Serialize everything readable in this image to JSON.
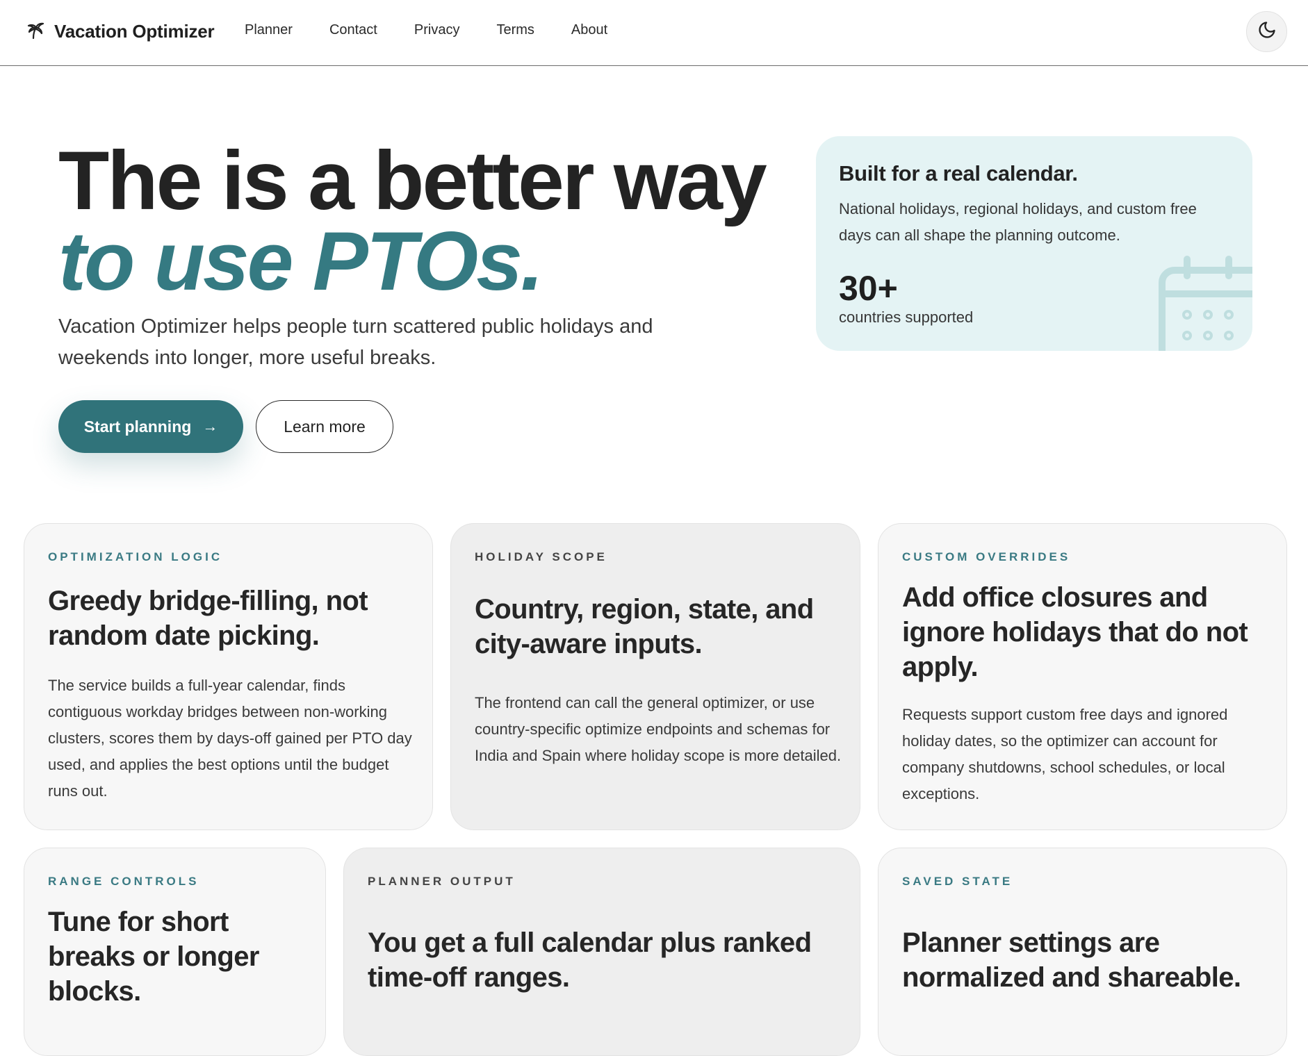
{
  "header": {
    "brand": "Vacation Optimizer",
    "nav": [
      "Planner",
      "Contact",
      "Privacy",
      "Terms",
      "About"
    ]
  },
  "hero": {
    "title_line1": "The is a better way",
    "title_line2": "to use PTOs.",
    "subtitle": "Vacation Optimizer helps people turn scattered public holidays and weekends into longer, more useful breaks.",
    "primary_cta": "Start planning",
    "secondary_cta": "Learn more"
  },
  "side_card": {
    "title": "Built for a real calendar.",
    "description": "National holidays, regional holidays, and custom free days can all shape the planning outcome.",
    "stat": "30+",
    "stat_label": "countries supported"
  },
  "cards": [
    {
      "eyebrow": "OPTIMIZATION LOGIC",
      "title": "Greedy bridge-filling, not random date picking.",
      "body": "The service builds a full-year calendar, finds contiguous workday bridges between non-working clusters, scores them by days-off gained per PTO day used, and applies the best options until the budget runs out."
    },
    {
      "eyebrow": "HOLIDAY SCOPE",
      "title": "Country, region, state, and city-aware inputs.",
      "body": "The frontend can call the general optimizer, or use country-specific optimize endpoints and schemas for India and Spain where holiday scope is more detailed."
    },
    {
      "eyebrow": "CUSTOM OVERRIDES",
      "title": "Add office closures and ignore holidays that do not apply.",
      "body": "Requests support custom free days and ignored holiday dates, so the optimizer can account for company shutdowns, school schedules, or local exceptions."
    },
    {
      "eyebrow": "RANGE CONTROLS",
      "title": "Tune for short breaks or longer blocks."
    },
    {
      "eyebrow": "PLANNER OUTPUT",
      "title": "You get a full calendar plus ranked time-off ranges."
    },
    {
      "eyebrow": "SAVED STATE",
      "title": "Planner settings are normalized and shareable."
    }
  ],
  "colors": {
    "accent": "#357a82",
    "primary_button": "#30737a",
    "side_card_bg": "#e4f3f4"
  },
  "icons": {
    "brand": "palm-tree-icon",
    "theme_toggle": "moon-icon",
    "cta_arrow": "arrow-right-icon",
    "side_card_decoration": "calendar-icon"
  }
}
